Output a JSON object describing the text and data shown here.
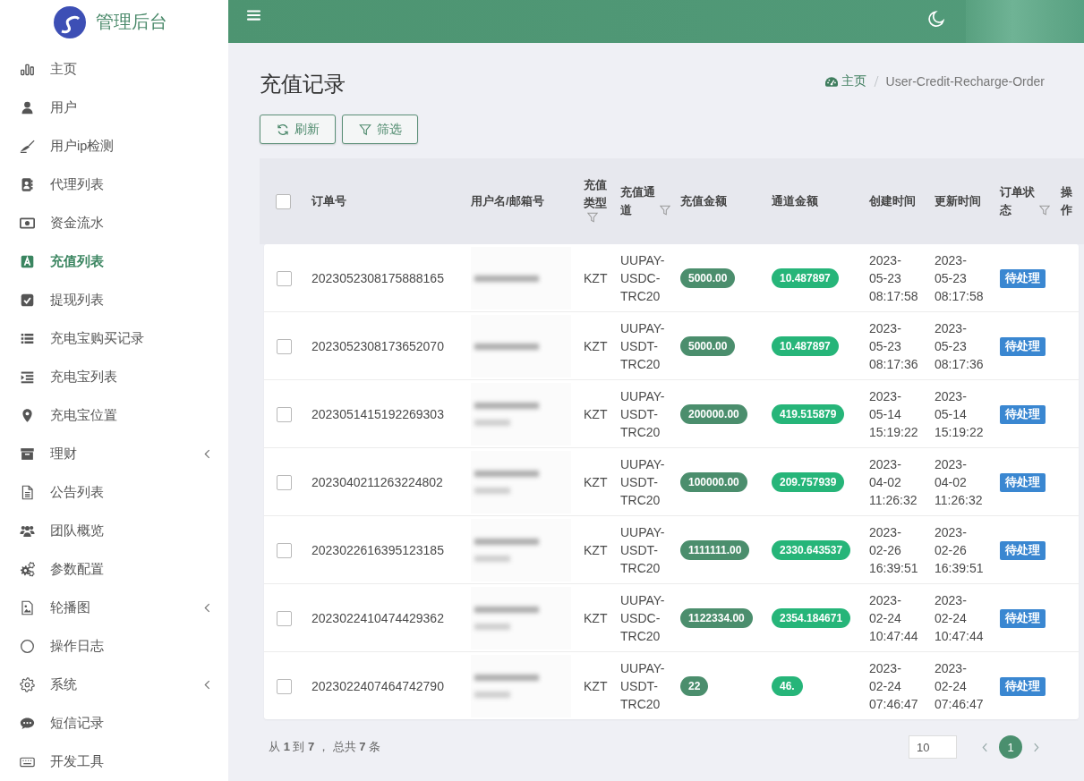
{
  "sidebar": {
    "title": "管理后台",
    "items": [
      {
        "label": "主页",
        "kind": "link",
        "selected": false
      },
      {
        "label": "用户",
        "kind": "link",
        "selected": false
      },
      {
        "label": "用户ip检测",
        "kind": "link",
        "selected": false
      },
      {
        "label": "代理列表",
        "kind": "link",
        "selected": false
      },
      {
        "label": "资金流水",
        "kind": "link",
        "selected": false
      },
      {
        "label": "充值列表",
        "kind": "link",
        "selected": true
      },
      {
        "label": "提现列表",
        "kind": "link",
        "selected": false
      },
      {
        "label": "充电宝购买记录",
        "kind": "link",
        "selected": false
      },
      {
        "label": "充电宝列表",
        "kind": "link",
        "selected": false
      },
      {
        "label": "充电宝位置",
        "kind": "link",
        "selected": false
      },
      {
        "label": "理财",
        "kind": "group",
        "selected": false,
        "expanded": false
      },
      {
        "label": "公告列表",
        "kind": "link",
        "selected": false
      },
      {
        "label": "团队概览",
        "kind": "link",
        "selected": false
      },
      {
        "label": "参数配置",
        "kind": "link",
        "selected": false
      },
      {
        "label": "轮播图",
        "kind": "group",
        "selected": false,
        "expanded": false
      },
      {
        "label": "操作日志",
        "kind": "link",
        "selected": false
      },
      {
        "label": "系统",
        "kind": "group",
        "selected": false,
        "expanded": false
      },
      {
        "label": "短信记录",
        "kind": "link",
        "selected": false
      },
      {
        "label": "开发工具",
        "kind": "link",
        "selected": false
      }
    ]
  },
  "page": {
    "title": "充值记录",
    "breadcrumb": [
      {
        "label": "主页",
        "kind": "home"
      },
      {
        "label": "User-Credit-Recharge-Order",
        "kind": "current"
      }
    ]
  },
  "toolbar": {
    "buttons": [
      {
        "label": "刷新"
      },
      {
        "label": "筛选"
      }
    ]
  },
  "table": {
    "select_all": {
      "checked": false
    },
    "columns": [
      {
        "label": "订单号",
        "filter": false
      },
      {
        "label": "用户名/邮箱号",
        "filter": false
      },
      {
        "label": "充值类型",
        "filter": true
      },
      {
        "label": "充值通道",
        "filter": true
      },
      {
        "label": "充值金额",
        "filter": false
      },
      {
        "label": "通道金额",
        "filter": false
      },
      {
        "label": "创建时间",
        "filter": false
      },
      {
        "label": "更新时间",
        "filter": false
      },
      {
        "label": "订单状态",
        "filter": true
      },
      {
        "label": "操作",
        "filter": false
      }
    ],
    "rows": [
      {
        "checked": false,
        "order_no": "2023052308175888165",
        "type": "KZT",
        "channel": "UUPAY-USDC-TRC20",
        "amount": "5000.00",
        "channel_amount": "10.487897",
        "created": "2023-05-23 08:17:58",
        "updated": "2023-05-23 08:17:58",
        "status": "待处理"
      },
      {
        "checked": false,
        "order_no": "2023052308173652070",
        "type": "KZT",
        "channel": "UUPAY-USDT-TRC20",
        "amount": "5000.00",
        "channel_amount": "10.487897",
        "created": "2023-05-23 08:17:36",
        "updated": "2023-05-23 08:17:36",
        "status": "待处理"
      },
      {
        "checked": false,
        "order_no": "2023051415192269303",
        "type": "KZT",
        "channel": "UUPAY-USDT-TRC20",
        "amount": "200000.00",
        "channel_amount": "419.515879",
        "created": "2023-05-14 15:19:22",
        "updated": "2023-05-14 15:19:22",
        "status": "待处理"
      },
      {
        "checked": false,
        "order_no": "2023040211263224802",
        "type": "KZT",
        "channel": "UUPAY-USDT-TRC20",
        "amount": "100000.00",
        "channel_amount": "209.757939",
        "created": "2023-04-02 11:26:32",
        "updated": "2023-04-02 11:26:32",
        "status": "待处理"
      },
      {
        "checked": false,
        "order_no": "2023022616395123185",
        "type": "KZT",
        "channel": "UUPAY-USDT-TRC20",
        "amount": "1111111.00",
        "channel_amount": "2330.643537",
        "created": "2023-02-26 16:39:51",
        "updated": "2023-02-26 16:39:51",
        "status": "待处理"
      },
      {
        "checked": false,
        "order_no": "2023022410474429362",
        "type": "KZT",
        "channel": "UUPAY-USDC-TRC20",
        "amount": "1122334.00",
        "channel_amount": "2354.184671",
        "created": "2023-02-24 10:47:44",
        "updated": "2023-02-24 10:47:44",
        "status": "待处理"
      },
      {
        "checked": false,
        "order_no": "2023022407464742790",
        "type": "KZT",
        "channel": "UUPAY-USDT-TRC20",
        "amount": "22",
        "channel_amount": "46.",
        "created": "2023-02-24 07:46:47",
        "updated": "2023-02-24 07:46:47",
        "status": "待处理"
      }
    ]
  },
  "pagination": {
    "summary": "从 **1** 到 **7** ， 总共 **7** 条",
    "page_size": "10",
    "pages": [
      {
        "label": "1",
        "selected": true
      }
    ]
  }
}
